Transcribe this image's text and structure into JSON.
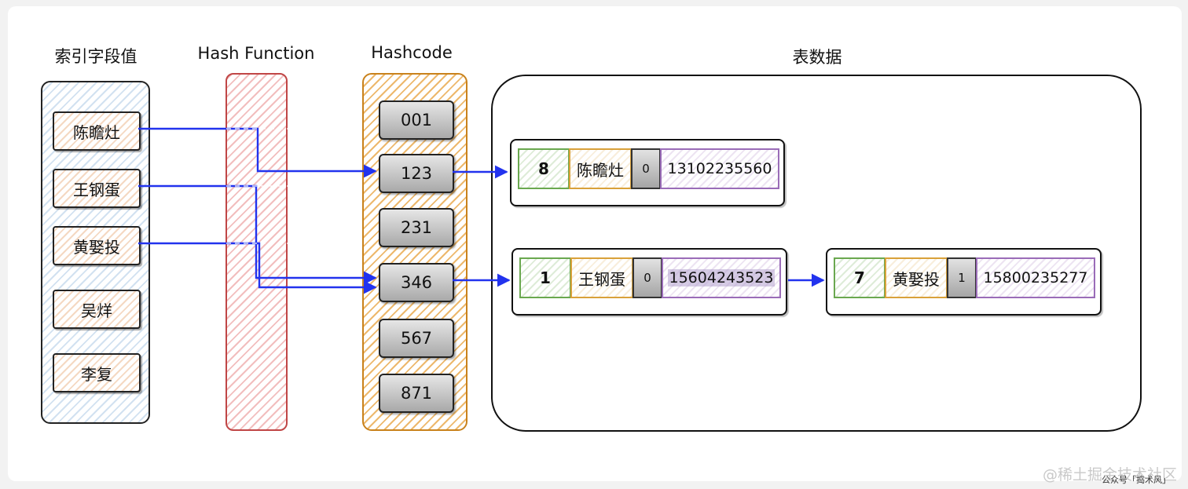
{
  "titles": {
    "keys": "索引字段值",
    "hash_function": "Hash Function",
    "hashcode": "Hashcode",
    "table": "表数据"
  },
  "keys": [
    "陈瞻灶",
    "王钢蛋",
    "黄娶投",
    "吴烊",
    "李复"
  ],
  "hashcodes": [
    "001",
    "123",
    "231",
    "346",
    "567",
    "871"
  ],
  "records": {
    "r1": {
      "id": "8",
      "name": "陈瞻灶",
      "flag": "0",
      "phone": "13102235560"
    },
    "r2": {
      "id": "1",
      "name": "王钢蛋",
      "flag": "0",
      "phone": "15604243523"
    },
    "r3": {
      "id": "7",
      "name": "黄娶投",
      "flag": "1",
      "phone": "15800235277"
    }
  },
  "watermark": {
    "main": "@稀土掘金技术社区",
    "sub": "公众号「捣术风」"
  },
  "colors": {
    "arrow": "#2233ee",
    "key_column_fill": "#7eaad6",
    "hash_function_fill": "#e26e6e",
    "hashcode_fill": "#e59a2e"
  }
}
